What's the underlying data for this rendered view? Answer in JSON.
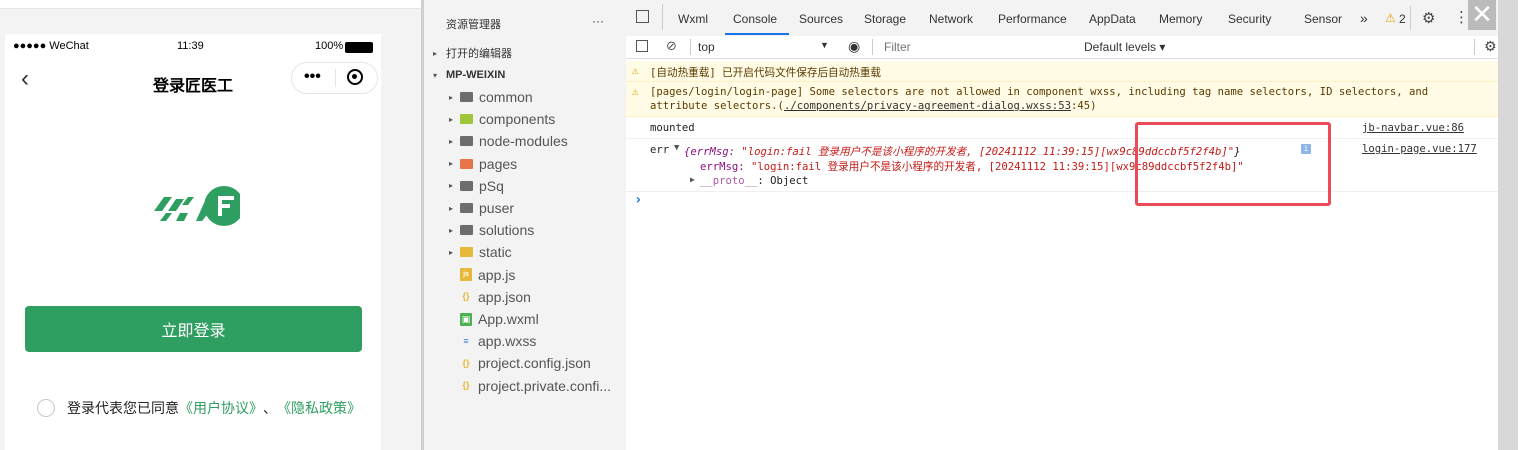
{
  "simulator": {
    "status_carrier": "●●●●● WeChat",
    "status_time": "11:39",
    "status_battery": "100%",
    "nav_title": "登录匠医工",
    "capsule_more": "•••",
    "login_button": "立即登录",
    "agree_text": "登录代表您已同意",
    "agree_link1": "《用户协议》",
    "agree_sep": "、",
    "agree_link2": "《隐私政策》"
  },
  "explorer": {
    "title": "资源管理器",
    "more": "···",
    "open_editors": "打开的编辑器",
    "project": "MP-WEIXIN",
    "items": [
      {
        "name": "common",
        "type": "folder",
        "color": "#6d6d6d"
      },
      {
        "name": "components",
        "type": "folder",
        "color": "#9fc63a"
      },
      {
        "name": "node-modules",
        "type": "folder",
        "color": "#6d6d6d"
      },
      {
        "name": "pages",
        "type": "folder",
        "color": "#e8754a"
      },
      {
        "name": "pSq",
        "type": "folder",
        "color": "#6d6d6d"
      },
      {
        "name": "puser",
        "type": "folder",
        "color": "#6d6d6d"
      },
      {
        "name": "solutions",
        "type": "folder",
        "color": "#6d6d6d"
      },
      {
        "name": "static",
        "type": "folder",
        "color": "#e6b93a"
      },
      {
        "name": "app.js",
        "type": "js",
        "color": "#e6b93a"
      },
      {
        "name": "app.json",
        "type": "json",
        "color": "#e6b93a"
      },
      {
        "name": "App.wxml",
        "type": "wxml",
        "color": "#4caf50"
      },
      {
        "name": "app.wxss",
        "type": "wxss",
        "color": "#3f7bd8"
      },
      {
        "name": "project.config.json",
        "type": "json",
        "color": "#e6b93a"
      },
      {
        "name": "project.private.confi...",
        "type": "json",
        "color": "#e6b93a"
      }
    ]
  },
  "devtools": {
    "tabs": [
      "Wxml",
      "Console",
      "Sources",
      "Storage",
      "Network",
      "Performance",
      "AppData",
      "Memory",
      "Security",
      "Sensor"
    ],
    "active_tab": "Console",
    "more_tabs": "»",
    "warning_count": "2",
    "context": "top",
    "filter_placeholder": "Filter",
    "levels": "Default levels ▾",
    "messages": {
      "hot_reload": "[自动热重载] 已开启代码文件保存后自动热重载",
      "selector_warn_1": "[pages/login/login-page] Some selectors are not allowed in component wxss, including tag name selectors, ID selectors, and",
      "selector_warn_2a": "attribute selectors.(",
      "selector_warn_link": "./components/privacy-agreement-dialog.wxss:53",
      "selector_warn_2b": ":45)",
      "mounted": "mounted",
      "mounted_source": "jb-navbar.vue:86",
      "err_label": "err",
      "err_summary_key": "{errMsg: ",
      "err_summary_val": "\"login:fail 登录用户不是该小程序的开发者, [20241112 11:39:15][wx9c89ddccbf5f2f4b]\"",
      "err_summary_end": "}",
      "err_source": "login-page.vue:177",
      "err_msg_key": "errMsg: ",
      "err_msg_val": "\"login:fail 登录用户不是该小程序的开发者, [20241112 11:39:15][wx9c89ddccbf5f2f4b]\"",
      "proto_key": "__proto__",
      "proto_val": ": Object",
      "prompt": "›"
    }
  }
}
